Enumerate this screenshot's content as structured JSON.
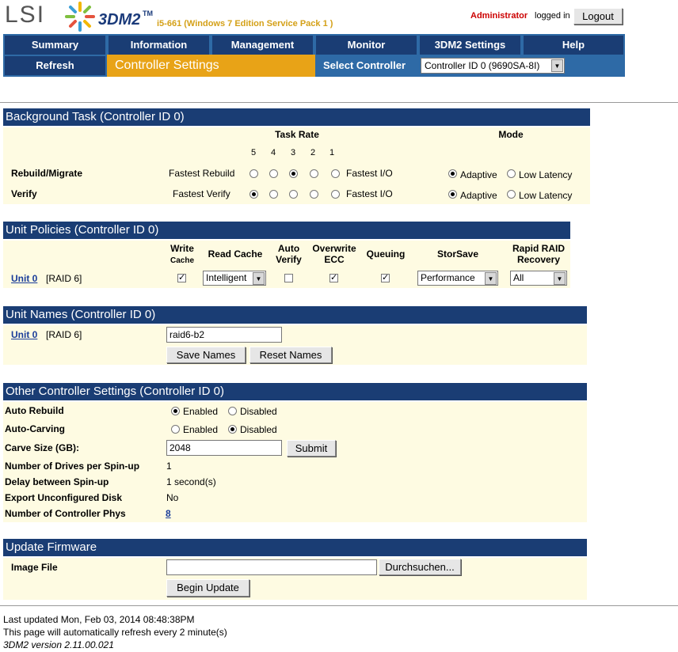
{
  "header": {
    "logo": "LSI",
    "product": "3DM2",
    "tm": "TM",
    "host": "i5-661 (Windows 7 Edition Service Pack 1 )",
    "user": "Administrator",
    "logged_in": "logged in",
    "logout": "Logout"
  },
  "nav": {
    "items": [
      "Summary",
      "Information",
      "Management",
      "Monitor",
      "3DM2 Settings",
      "Help"
    ],
    "refresh": "Refresh",
    "page_title": "Controller Settings",
    "select_label": "Select Controller",
    "selected_controller": "Controller ID 0 (9690SA-8I)"
  },
  "background_task": {
    "title": "Background Task (Controller ID 0)",
    "task_rate": "Task Rate",
    "mode": "Mode",
    "rates": [
      "5",
      "4",
      "3",
      "2",
      "1"
    ],
    "rows": [
      {
        "label": "Rebuild/Migrate",
        "left": "Fastest Rebuild",
        "right": "Fastest I/O",
        "selected_rate": "3",
        "mode": "Adaptive"
      },
      {
        "label": "Verify",
        "left": "Fastest Verify",
        "right": "Fastest I/O",
        "selected_rate": "5",
        "mode": "Adaptive"
      }
    ],
    "adaptive": "Adaptive",
    "low_latency": "Low Latency"
  },
  "unit_policies": {
    "title": "Unit Policies (Controller ID 0)",
    "headers": {
      "write": "Write",
      "cache": "Cache",
      "read_cache": "Read Cache",
      "auto": "Auto",
      "verify": "Verify",
      "overwrite": "Overwrite",
      "ecc": "ECC",
      "queuing": "Queuing",
      "storsave": "StorSave",
      "rapid": "Rapid RAID",
      "recovery": "Recovery"
    },
    "unit": "Unit 0",
    "raid": "[RAID 6]",
    "read_cache_value": "Intelligent",
    "storsave_value": "Performance",
    "rapid_value": "All"
  },
  "unit_names": {
    "title": "Unit Names (Controller ID 0)",
    "unit": "Unit 0",
    "raid": "[RAID 6]",
    "name_value": "raid6-b2",
    "save": "Save Names",
    "reset": "Reset Names"
  },
  "other": {
    "title": "Other Controller Settings (Controller ID 0)",
    "auto_rebuild": "Auto Rebuild",
    "auto_carving": "Auto-Carving",
    "enabled": "Enabled",
    "disabled": "Disabled",
    "carve_size": "Carve Size (GB):",
    "carve_value": "2048",
    "submit": "Submit",
    "drives_spinup": "Number of Drives per Spin-up",
    "drives_spinup_value": "1",
    "delay": "Delay between Spin-up",
    "delay_value": "1 second(s)",
    "export": "Export Unconfigured Disk",
    "export_value": "No",
    "phys": "Number of Controller Phys",
    "phys_value": "8"
  },
  "firmware": {
    "title": "Update Firmware",
    "image_file": "Image File",
    "browse": "Durchsuchen...",
    "begin": "Begin Update"
  },
  "footer": {
    "updated": "Last updated Mon, Feb 03, 2014 08:48:38PM",
    "refresh": "This page will automatically refresh every 2 minute(s)",
    "version": "3DM2 version 2.11.00.021"
  },
  "colors": {
    "nav_dark": "#1a3d74",
    "nav_bar": "#2e6aa6",
    "accent": "#e8a317",
    "row_bg": "#fefbe2"
  }
}
